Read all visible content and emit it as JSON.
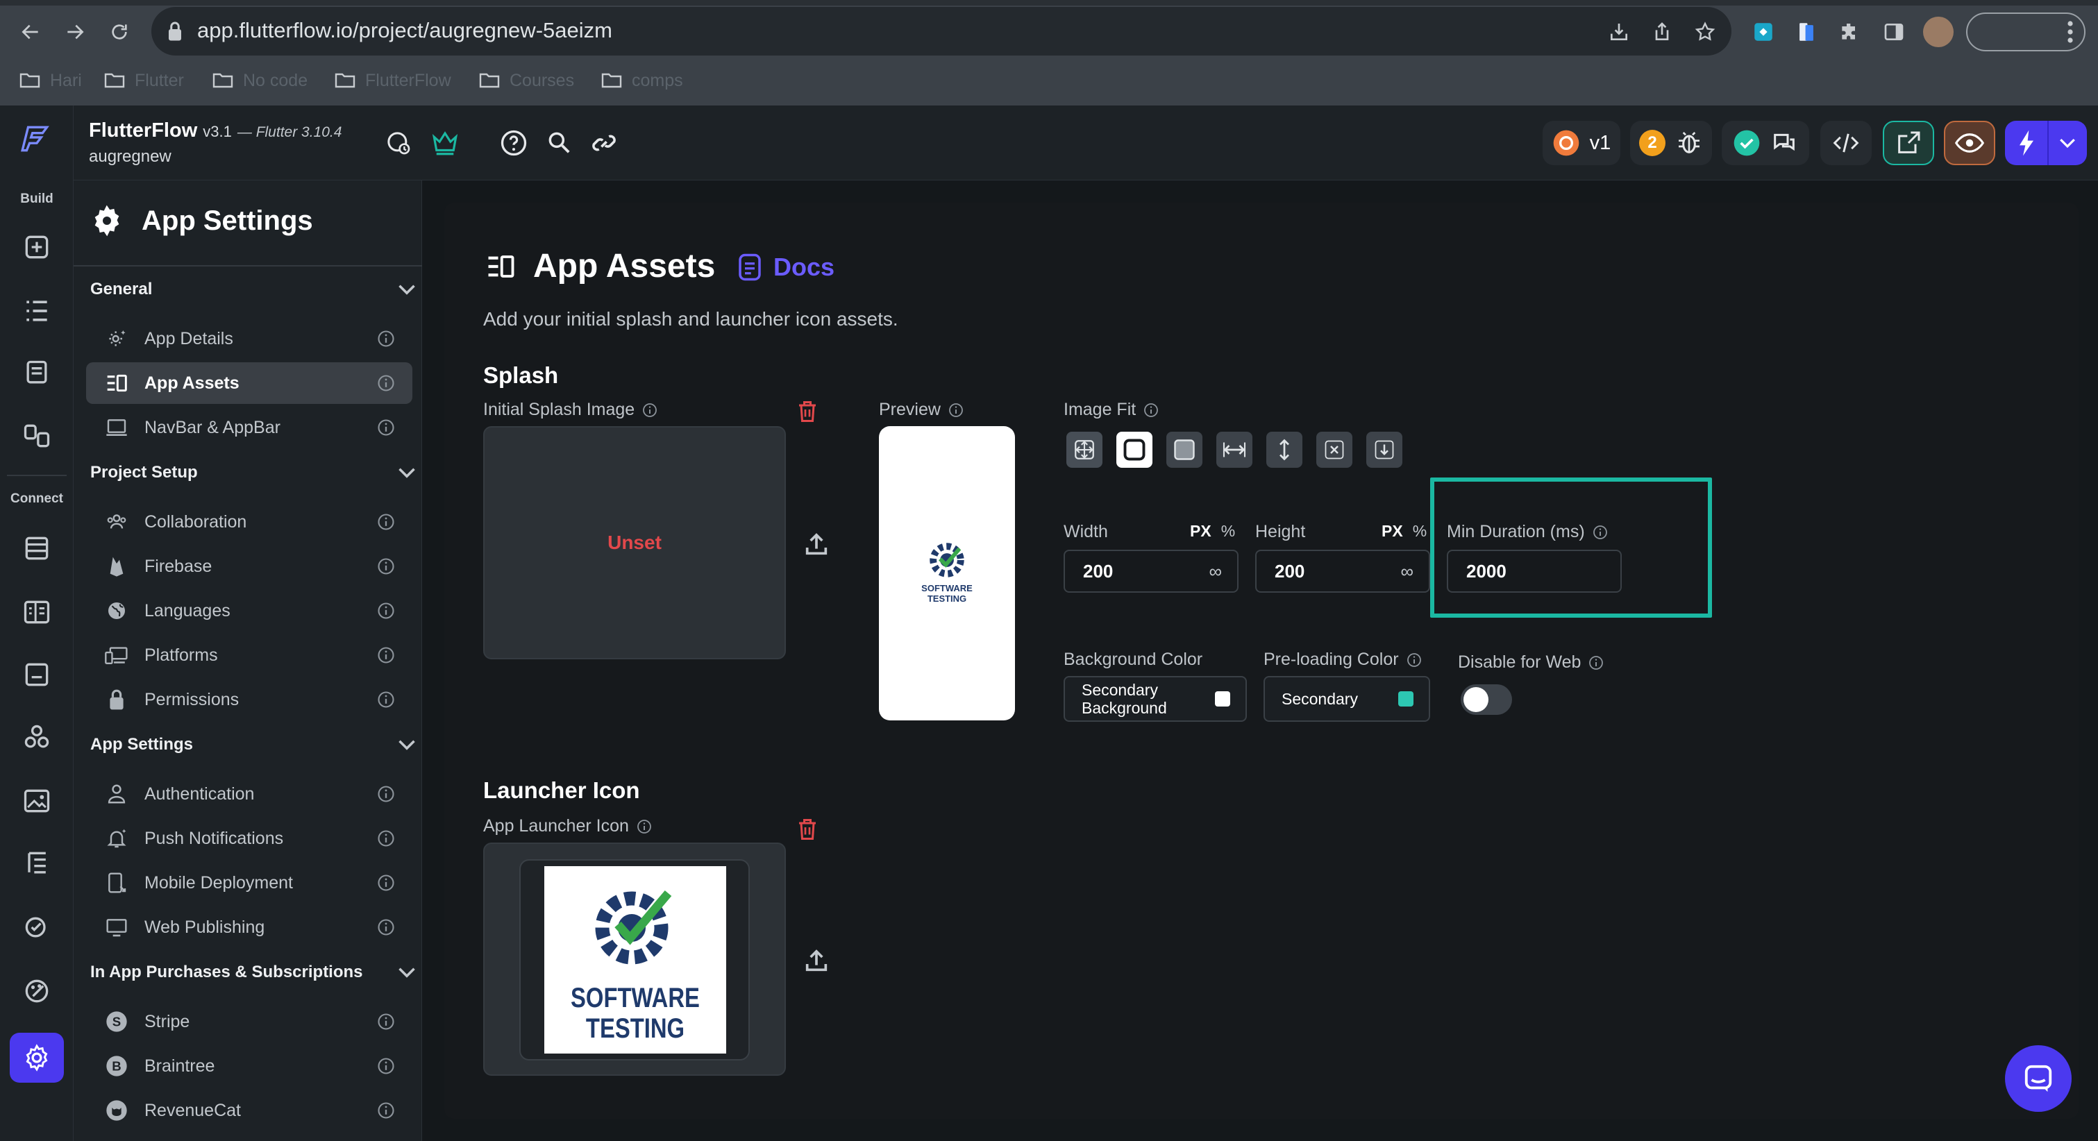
{
  "browser": {
    "url": "app.flutterflow.io/project/augregnew-5aeizm",
    "bookmarks": [
      "Hari",
      "Flutter",
      "No code",
      "FlutterFlow",
      "Courses",
      "comps"
    ]
  },
  "app": {
    "brand": "FlutterFlow",
    "version": "v3.1",
    "flutter_version": "— Flutter 3.10.4",
    "project_name": "augregnew",
    "version_badge": "v1",
    "issues_count": "2"
  },
  "rail": {
    "build_label": "Build",
    "connect_label": "Connect"
  },
  "sidebar": {
    "title": "App Settings",
    "sections": [
      {
        "name": "General",
        "items": [
          "App Details",
          "App Assets",
          "NavBar & AppBar"
        ]
      },
      {
        "name": "Project Setup",
        "items": [
          "Collaboration",
          "Firebase",
          "Languages",
          "Platforms",
          "Permissions"
        ]
      },
      {
        "name": "App Settings",
        "items": [
          "Authentication",
          "Push Notifications",
          "Mobile Deployment",
          "Web Publishing"
        ]
      },
      {
        "name": "In App Purchases & Subscriptions",
        "items": [
          "Stripe",
          "Braintree",
          "RevenueCat"
        ]
      }
    ]
  },
  "main": {
    "title": "App Assets",
    "docs_label": "Docs",
    "subtitle": "Add your initial splash and launcher icon assets.",
    "splash": {
      "heading": "Splash",
      "image_label": "Initial Splash Image",
      "unset_text": "Unset",
      "preview_label": "Preview",
      "image_fit_label": "Image Fit",
      "width_label": "Width",
      "width_unit_px": "PX",
      "width_unit_pct": "%",
      "width_value": "200",
      "height_label": "Height",
      "height_unit_px": "PX",
      "height_unit_pct": "%",
      "height_value": "200",
      "infinity": "∞",
      "min_duration_label": "Min Duration (ms)",
      "min_duration_value": "2000",
      "bg_color_label": "Background Color",
      "bg_color_line1": "Secondary",
      "bg_color_line2": "Background",
      "preload_color_label": "Pre-loading Color",
      "preload_color_value": "Secondary",
      "disable_web_label": "Disable for Web"
    },
    "launcher": {
      "heading": "Launcher Icon",
      "icon_label": "App Launcher Icon"
    },
    "logo_text_line1": "SOFTWARE",
    "logo_text_line2": "TESTING"
  },
  "colors": {
    "accent_teal": "#1bb8a2",
    "danger": "#e2484b",
    "primary_blue": "#4b39ef",
    "docs_blue": "#6b5cff"
  }
}
